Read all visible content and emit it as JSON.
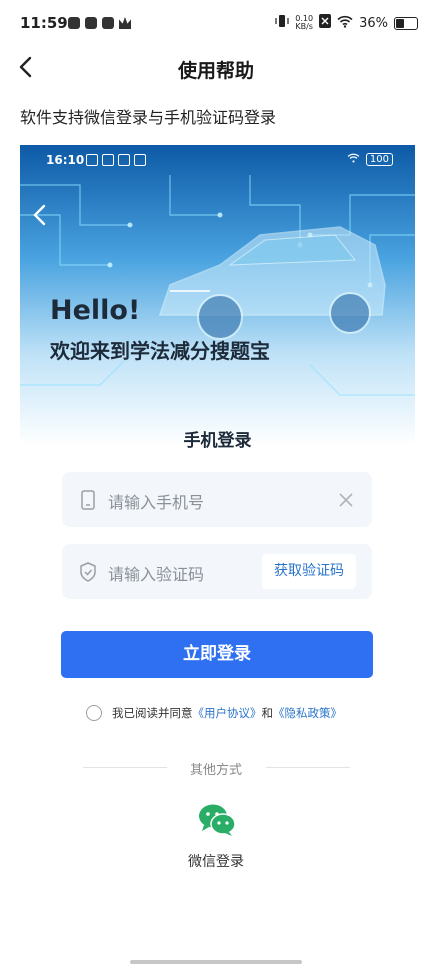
{
  "status_bar": {
    "time": "11:59",
    "speed_top": "0.10",
    "speed_bottom": "KB/s",
    "battery": "36%",
    "battery_level": 0.36
  },
  "nav": {
    "title": "使用帮助"
  },
  "section": {
    "title": "软件支持微信登录与手机验证码登录"
  },
  "embedded": {
    "status_time": "16:10",
    "status_battery": "100",
    "hero_hello": "Hello!",
    "hero_welcome": "欢迎来到学法减分搜题宝",
    "login_title": "手机登录"
  },
  "form": {
    "phone_placeholder": "请输入手机号",
    "code_placeholder": "请输入验证码",
    "get_code_label": "获取验证码",
    "login_label": "立即登录"
  },
  "agreement": {
    "prefix": "我已阅读并同意",
    "user_agreement": "《用户协议》",
    "conjunction": "和",
    "privacy_policy": "《隐私政策》"
  },
  "other": {
    "label": "其他方式",
    "wechat_label": "微信登录"
  },
  "colors": {
    "primary_button": "#2f6ff2",
    "link": "#2a73c9",
    "wechat_green": "#2aae67"
  }
}
